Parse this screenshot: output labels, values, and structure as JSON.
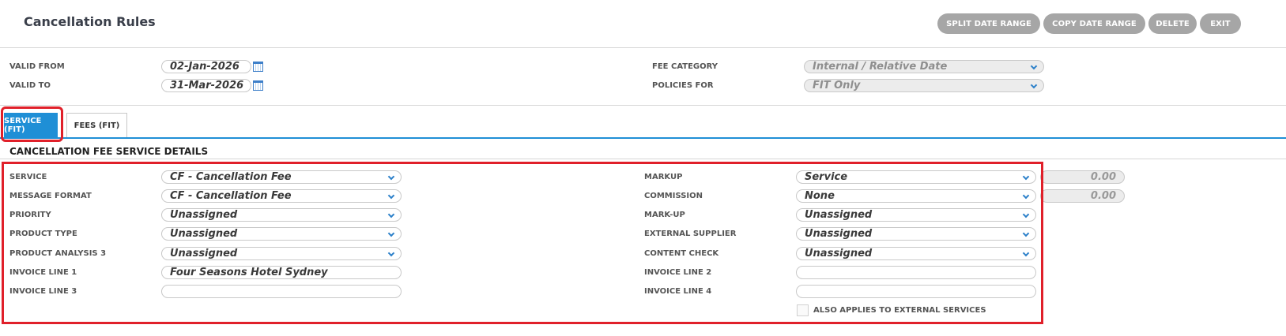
{
  "page": {
    "title": "Cancellation Rules"
  },
  "toolbar": {
    "split_label": "SPLIT DATE RANGE",
    "copy_label": "COPY DATE RANGE",
    "delete_label": "DELETE",
    "exit_label": "EXIT"
  },
  "header": {
    "valid_from_label": "VALID FROM",
    "valid_from_value": "02-Jan-2026",
    "valid_to_label": "VALID TO",
    "valid_to_value": "31-Mar-2026",
    "fee_category_label": "FEE CATEGORY",
    "fee_category_value": "Internal / Relative Date",
    "policies_for_label": "POLICIES FOR",
    "policies_for_value": "FIT Only"
  },
  "tabs": [
    {
      "label": "SERVICE (FIT)",
      "active": true
    },
    {
      "label": "FEES (FIT)",
      "active": false
    }
  ],
  "section": {
    "title": "CANCELLATION FEE SERVICE DETAILS"
  },
  "form": {
    "service_label": "SERVICE",
    "service_value": "CF - Cancellation Fee",
    "message_format_label": "MESSAGE FORMAT",
    "message_format_value": "CF - Cancellation Fee",
    "priority_label": "PRIORITY",
    "priority_value": "Unassigned",
    "product_type_label": "PRODUCT TYPE",
    "product_type_value": "Unassigned",
    "product_analysis_label": "PRODUCT ANALYSIS 3",
    "product_analysis_value": "Unassigned",
    "invoice_line1_label": "INVOICE LINE 1",
    "invoice_line1_value": "Four Seasons Hotel Sydney",
    "invoice_line3_label": "INVOICE LINE 3",
    "invoice_line3_value": "",
    "markup_label": "MARKUP",
    "markup_value": "Service",
    "markup_amount": "0.00",
    "commission_label": "COMMISSION",
    "commission_value": "None",
    "commission_amount": "0.00",
    "mark_up_label": "MARK-UP",
    "mark_up_value": "Unassigned",
    "external_supplier_label": "EXTERNAL SUPPLIER",
    "external_supplier_value": "Unassigned",
    "content_check_label": "CONTENT CHECK",
    "content_check_value": "Unassigned",
    "invoice_line2_label": "INVOICE LINE 2",
    "invoice_line2_value": "",
    "invoice_line4_label": "INVOICE LINE 4",
    "invoice_line4_value": "",
    "also_applies_label": "ALSO APPLIES TO EXTERNAL SERVICES"
  },
  "colors": {
    "accent": "#1f8fd6",
    "highlight": "#e0202a",
    "button": "#a6a6a6"
  }
}
